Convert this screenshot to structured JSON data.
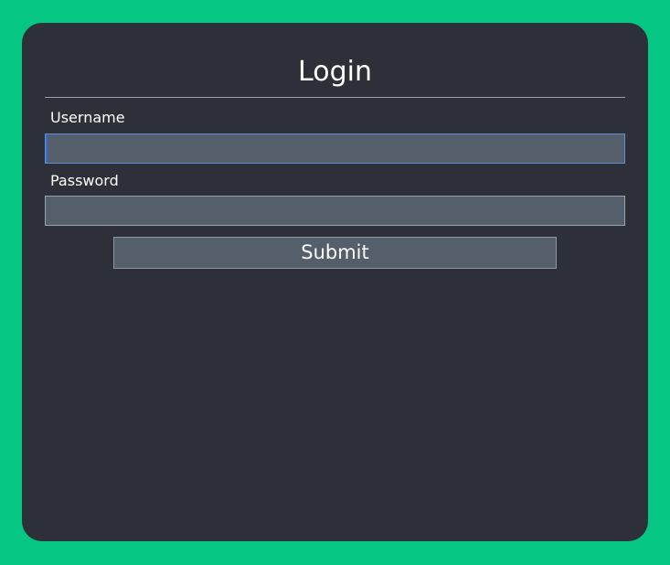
{
  "colors": {
    "page_background": "#05c683",
    "card_background": "#2d3038",
    "field_background": "#545f6b",
    "text": "#ffffff",
    "focus_border": "#5e8ed0"
  },
  "form": {
    "title": "Login",
    "username_label": "Username",
    "username_value": "",
    "password_label": "Password",
    "password_value": "",
    "submit_label": "Submit"
  }
}
